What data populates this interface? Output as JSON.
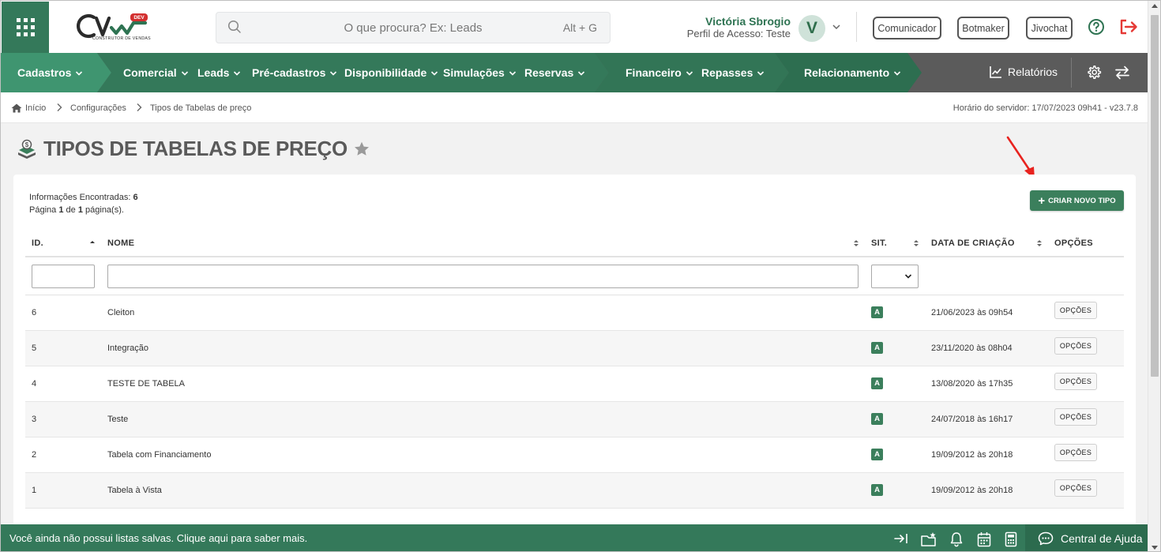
{
  "header": {
    "logo_sub": "CONSTRUTOR DE VENDAS",
    "logo_badge": "DEV",
    "search_placeholder": "O que procura? Ex: Leads",
    "search_shortcut": "Alt + G",
    "user_name": "Victória Sbrogio",
    "user_profile": "Perfil de Acesso: Teste",
    "avatar_initial": "V",
    "buttons": [
      "Comunicador",
      "Botmaker",
      "Jivochat"
    ]
  },
  "nav": {
    "items": [
      "Cadastros",
      "Comercial",
      "Leads",
      "Pré-cadastros",
      "Disponibilidade",
      "Simulações",
      "Reservas",
      "Financeiro",
      "Repasses",
      "Relacionamento"
    ],
    "reports": "Relatórios"
  },
  "breadcrumb": {
    "items": [
      "Início",
      "Configurações",
      "Tipos de Tabelas de preço"
    ],
    "server_time": "Horário do servidor: 17/07/2023 09h41 - v23.7.8"
  },
  "page": {
    "title": "TIPOS DE TABELAS DE PREÇO",
    "found_label": "Informações Encontradas:",
    "found_count": "6",
    "page_prefix": "Página",
    "page_current": "1",
    "page_of": "de",
    "page_total": "1",
    "page_suffix": "página(s).",
    "create_button": "CRIAR NOVO TIPO"
  },
  "table": {
    "columns": [
      "ID.",
      "NOME",
      "SIT.",
      "DATA DE CRIAÇÃO",
      "OPÇÕES"
    ],
    "rows": [
      {
        "id": "6",
        "name": "Cleiton",
        "sit": "A",
        "date": "21/06/2023 às 09h54",
        "opt": "OPÇÕES"
      },
      {
        "id": "5",
        "name": "Integração",
        "sit": "A",
        "date": "23/11/2020 às 08h04",
        "opt": "OPÇÕES"
      },
      {
        "id": "4",
        "name": "TESTE DE TABELA",
        "sit": "A",
        "date": "13/08/2020 às 17h35",
        "opt": "OPÇÕES"
      },
      {
        "id": "3",
        "name": "Teste",
        "sit": "A",
        "date": "24/07/2018 às 16h17",
        "opt": "OPÇÕES"
      },
      {
        "id": "2",
        "name": "Tabela com Financiamento",
        "sit": "A",
        "date": "19/09/2012 às 20h18",
        "opt": "OPÇÕES"
      },
      {
        "id": "1",
        "name": "Tabela à Vista",
        "sit": "A",
        "date": "19/09/2012 às 20h18",
        "opt": "OPÇÕES"
      }
    ]
  },
  "footer": {
    "message": "Você ainda não possui listas salvas. Clique aqui para saber mais.",
    "help": "Central de Ajuda"
  },
  "colors": {
    "brand_green": "#34795a",
    "nav_gray": "#5b5b5b",
    "badge_green": "#3b7f5c",
    "logout_red": "#e53935"
  }
}
